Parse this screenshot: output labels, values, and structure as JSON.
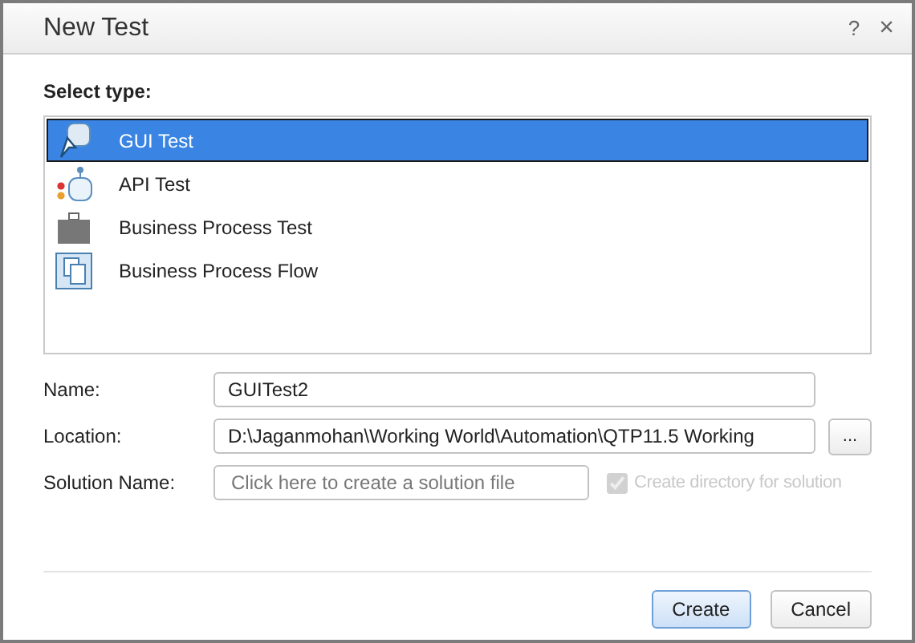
{
  "window": {
    "title": "New Test",
    "help": "?",
    "close": "×"
  },
  "select_type": {
    "label": "Select type:",
    "items": [
      {
        "label": "GUI Test",
        "kind": "gui",
        "selected": true
      },
      {
        "label": "API Test",
        "kind": "api",
        "selected": false
      },
      {
        "label": "Business Process Test",
        "kind": "bpt",
        "selected": false
      },
      {
        "label": "Business Process Flow",
        "kind": "flow",
        "selected": false
      }
    ]
  },
  "name": {
    "label": "Name:",
    "value": "GUITest2"
  },
  "location": {
    "label": "Location:",
    "value": "D:\\Jaganmohan\\Working World\\Automation\\QTP11.5 Working",
    "browse": "..."
  },
  "solution": {
    "label": "Solution Name:",
    "placeholder": "Click here to create a solution file",
    "checkbox": {
      "label": "Create directory for solution",
      "checked": true,
      "disabled": true
    }
  },
  "buttons": [
    {
      "label": "Create",
      "kind": "default"
    },
    {
      "label": "Cancel",
      "kind": "normal"
    }
  ]
}
